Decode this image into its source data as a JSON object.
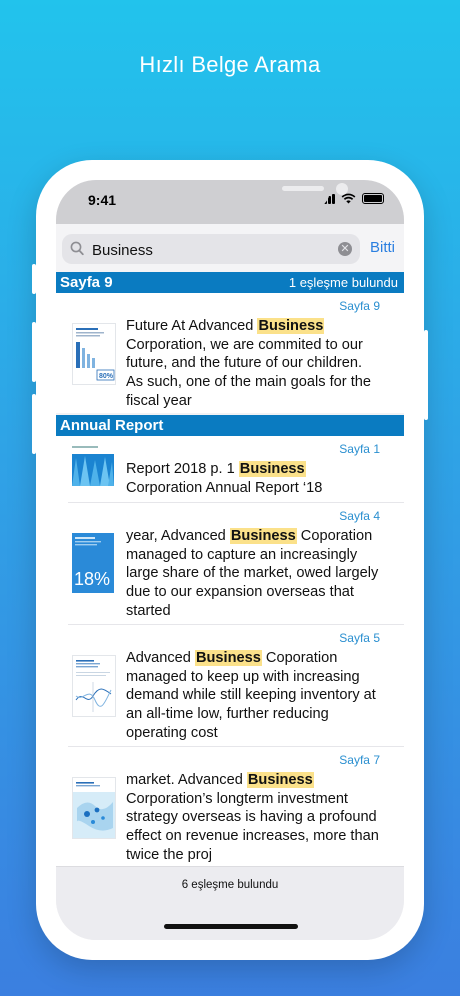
{
  "headline": "Hızlı Belge Arama",
  "status_bar": {
    "time": "9:41"
  },
  "search": {
    "value": "Business",
    "done_label": "Bitti"
  },
  "sections": [
    {
      "title": "Sayfa 9",
      "count": "1 eşleşme bulundu",
      "results": [
        {
          "page": "Sayfa 9",
          "before": "Future At Advanced ",
          "match": "Business",
          "after": " Corporation, we are commited to our future, and the future of our children. As such, one of the main goals for the fiscal year",
          "thumb_text": "80%"
        }
      ]
    },
    {
      "title": "Annual Report",
      "results": [
        {
          "page": "Sayfa 1",
          "before": "Report 2018 p. 1 ",
          "match": "Business",
          "after": " Corporation Annual Report ‘18"
        },
        {
          "page": "Sayfa 4",
          "before": "year, Advanced ",
          "match": "Business",
          "after": " Coporation managed to capture an increasingly large share of the market, owed largely due to our expansion overseas that started",
          "thumb_text": "18%"
        },
        {
          "page": "Sayfa 5",
          "before": "Advanced ",
          "match": "Business",
          "after": " Coporation managed to keep up with increasing demand while still keeping inventory at an all-time low, further reducing operating cost"
        },
        {
          "page": "Sayfa 7",
          "before": "market. Advanced ",
          "match": "Business",
          "after": " Corporation’s longterm investment strategy overseas is having a profound effect on revenue increases, more than twice the proj"
        }
      ]
    }
  ],
  "footer": {
    "summary": "6 eşleşme bulundu"
  },
  "colors": {
    "accent": "#2a7fe0",
    "section_header": "#0a7bc1",
    "highlight": "#fbe18a"
  }
}
